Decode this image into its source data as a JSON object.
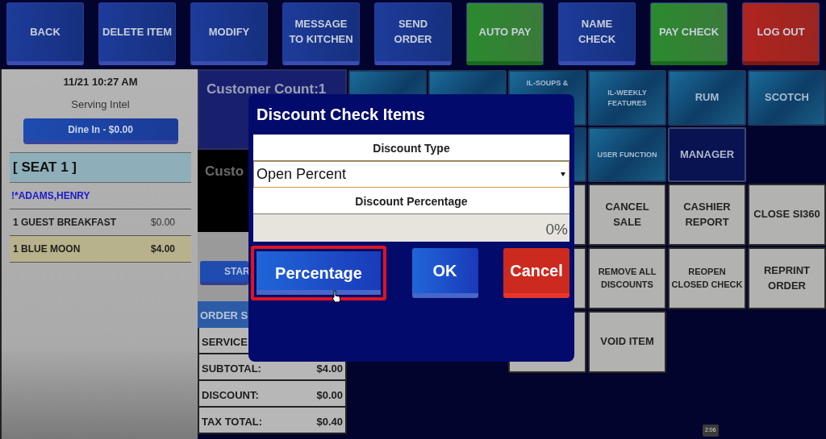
{
  "toolbar": [
    {
      "label": "BACK",
      "kind": "blue"
    },
    {
      "label": "DELETE ITEM",
      "kind": "blue"
    },
    {
      "label": "MODIFY",
      "kind": "blue"
    },
    {
      "label": "MESSAGE TO KITCHEN",
      "kind": "blue"
    },
    {
      "label": "SEND ORDER",
      "kind": "blue"
    },
    {
      "label": "AUTO PAY",
      "kind": "green"
    },
    {
      "label": "NAME CHECK",
      "kind": "blue"
    },
    {
      "label": "PAY CHECK",
      "kind": "green"
    },
    {
      "label": "LOG OUT",
      "kind": "red"
    }
  ],
  "check": {
    "datetime": "11/21 10:27 AM",
    "server": "Serving Intel",
    "order_type_button": "Dine In - $0.00",
    "seat": "[ SEAT 1 ]",
    "customer": "!*ADAMS,HENRY",
    "items": [
      {
        "name": "1 GUEST BREAKFAST",
        "price": "$0.00",
        "selected": false
      },
      {
        "name": "1 BLUE MOON",
        "price": "$4.00",
        "selected": true
      }
    ]
  },
  "middle": {
    "customer_count": "Customer Count:1",
    "customer_label": "Custo",
    "start_button": "STAR",
    "summary_header": "ORDER S",
    "summary": [
      {
        "label": "SERVICE"
      },
      {
        "label": "SUBTOTAL:",
        "value": "$4.00"
      },
      {
        "label": "DISCOUNT:",
        "value": "$0.00"
      },
      {
        "label": "TAX TOTAL:",
        "value": "$0.40"
      }
    ]
  },
  "tiles": [
    {
      "kind": "category"
    },
    {
      "kind": "category"
    },
    {
      "kind": "category",
      "label": "IL-SOUPS &"
    },
    {
      "kind": "category",
      "label": "IL-WEEKLY FEATURES"
    },
    {
      "kind": "category",
      "label": "RUM"
    },
    {
      "kind": "category",
      "label": "SCOTCH"
    },
    {
      "kind": "blank"
    },
    {
      "kind": "blank"
    },
    {
      "kind": "category"
    },
    {
      "kind": "category",
      "label": "USER FUNCTION"
    },
    {
      "kind": "manager",
      "label": "MANAGER"
    },
    {
      "kind": "blank"
    },
    {
      "kind": "blank"
    },
    {
      "kind": "blank"
    },
    {
      "kind": "function"
    },
    {
      "kind": "function",
      "label": "CANCEL SALE"
    },
    {
      "kind": "function",
      "label": "CASHIER REPORT"
    },
    {
      "kind": "function",
      "label": "CLOSE SI360"
    },
    {
      "kind": "blank"
    },
    {
      "kind": "blank"
    },
    {
      "kind": "function"
    },
    {
      "kind": "function",
      "label": "REMOVE ALL DISCOUNTS"
    },
    {
      "kind": "function",
      "label": "REOPEN CLOSED CHECK"
    },
    {
      "kind": "function",
      "label": "REPRINT ORDER"
    },
    {
      "kind": "blank"
    },
    {
      "kind": "blank"
    },
    {
      "kind": "function"
    },
    {
      "kind": "function",
      "label": "VOID ITEM"
    },
    {
      "kind": "blank"
    },
    {
      "kind": "blank"
    }
  ],
  "dialog": {
    "title": "Discount Check Items",
    "type_label": "Discount Type",
    "type_value": "Open Percent",
    "percent_label": "Discount Percentage",
    "percent_value": "0%",
    "buttons": [
      {
        "label": "Percentage",
        "kind": "blue",
        "highlighted": true
      },
      {
        "label": "OK",
        "kind": "blue",
        "highlighted": false
      },
      {
        "label": "Cancel",
        "kind": "red",
        "highlighted": false
      }
    ]
  },
  "video_time": "2:06"
}
